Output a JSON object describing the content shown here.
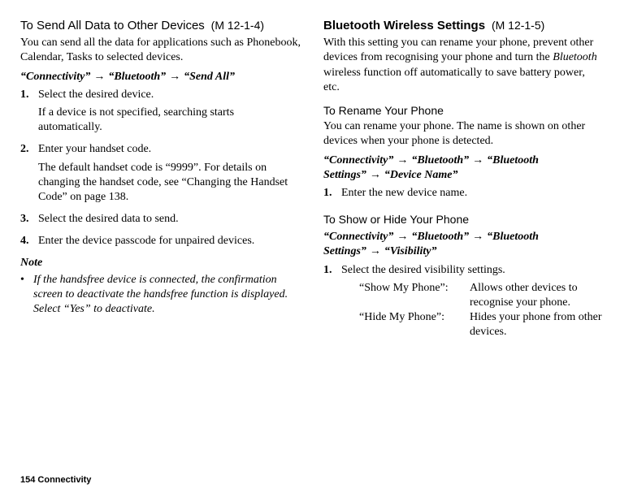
{
  "left": {
    "heading": "To Send All Data to Other Devices",
    "menu_ref": " (M 12-1-4)",
    "intro": "You can send all the data for applications such as Phonebook, Calendar, Tasks to selected devices.",
    "path_p1": "“Connectivity”",
    "path_p2": "“Bluetooth”",
    "path_p3": "“Send All”",
    "arrow": "→",
    "steps": {
      "s1_num": "1.",
      "s1_text": "Select the desired device.",
      "s1_sub": "If a device is not specified, searching starts automatically.",
      "s2_num": "2.",
      "s2_text": "Enter your handset code.",
      "s2_sub": "The default handset code is “9999”. For details on changing the handset code, see “Changing the Handset Code” on page 138.",
      "s3_num": "3.",
      "s3_text": "Select the desired data to send.",
      "s4_num": "4.",
      "s4_text": "Enter the device passcode for unpaired devices."
    },
    "note_heading": "Note",
    "note_bullet": "•",
    "note_text": "If the handsfree device is connected, the confirmation screen to deactivate the handsfree function is displayed. Select “Yes” to deactivate."
  },
  "right": {
    "heading": "Bluetooth Wireless Settings",
    "menu_ref": " (M 12-1-5)",
    "intro_pre": "With this setting you can rename your phone, prevent other devices from recognising your phone and turn the ",
    "intro_italic": "Bluetooth",
    "intro_post": " wireless function off automatically to save battery power, etc.",
    "rename": {
      "heading": "To Rename Your Phone",
      "intro": "You can rename your phone. The name is shown on other devices when your phone is detected.",
      "path_p1": "“Connectivity”",
      "path_p2": "“Bluetooth”",
      "path_p3": "“Bluetooth Settings”",
      "path_p4": "“Device Name”",
      "arrow": "→",
      "step_num": "1.",
      "step_text": "Enter the new device name."
    },
    "visibility": {
      "heading": "To Show or Hide Your Phone",
      "path_p1": "“Connectivity”",
      "path_p2": "“Bluetooth”",
      "path_p3": "“Bluetooth Settings”",
      "path_p4": "“Visibility”",
      "arrow": "→",
      "step_num": "1.",
      "step_text": "Select the desired visibility settings.",
      "opts": {
        "a_label": "“Show My Phone”:",
        "a_desc": "Allows other devices to recognise your phone.",
        "b_label": "“Hide My Phone”:",
        "b_desc": "Hides your phone from other devices."
      }
    }
  },
  "footer": "154   Connectivity"
}
